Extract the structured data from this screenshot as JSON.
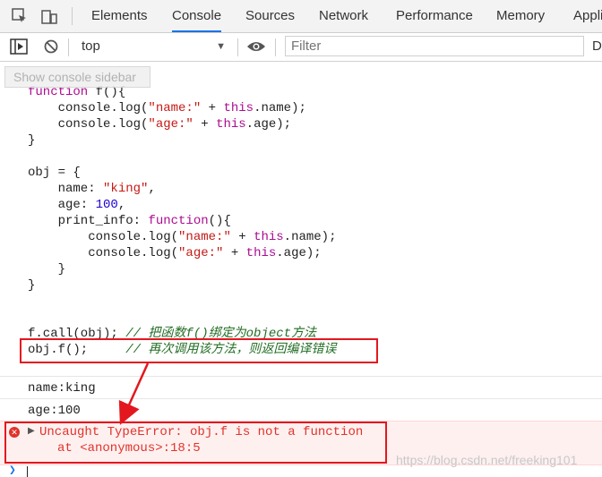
{
  "tabs": [
    {
      "label": "Elements"
    },
    {
      "label": "Console",
      "active": true
    },
    {
      "label": "Sources"
    },
    {
      "label": "Network"
    },
    {
      "label": "Performance"
    },
    {
      "label": "Memory"
    },
    {
      "label": "Appli"
    }
  ],
  "toolbar": {
    "context": "top",
    "filter_placeholder": "Filter",
    "truncated_label": "D"
  },
  "tooltip": "Show console sidebar",
  "console": {
    "log_lines": [
      "name:king",
      "age:100"
    ],
    "error": {
      "message": "Uncaught TypeError: obj.f is not a function",
      "location": "at <anonymous>:18:5"
    }
  },
  "watermark": "https://blog.csdn.net/freeking101",
  "colors": {
    "accent": "#1a73e8",
    "error": "#e0332a",
    "annotation": "#e3171e"
  }
}
